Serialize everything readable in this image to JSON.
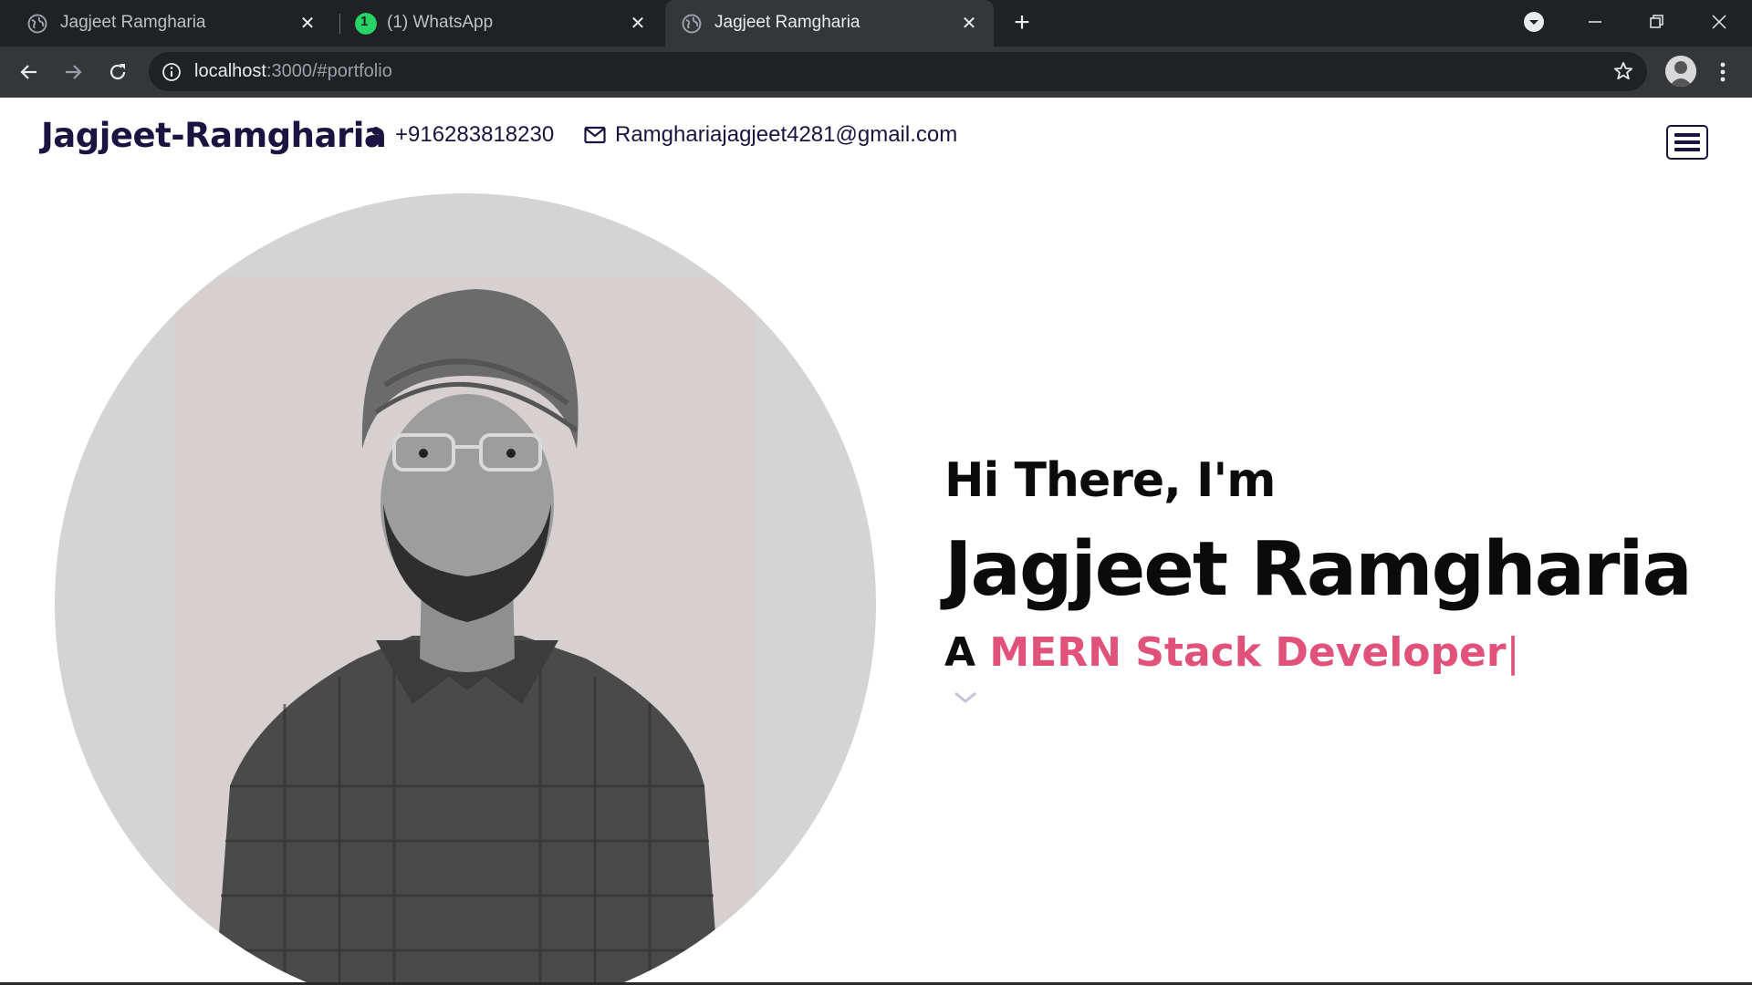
{
  "browser": {
    "tabs": [
      {
        "title": "Jagjeet Ramgharia",
        "icon": "globe-icon",
        "active": false
      },
      {
        "title": "(1) WhatsApp",
        "icon": "whatsapp-icon",
        "badge": "1",
        "active": false
      },
      {
        "title": "Jagjeet Ramgharia",
        "icon": "globe-icon",
        "active": true
      }
    ],
    "url_host": "localhost",
    "url_rest": ":3000/#portfolio"
  },
  "site": {
    "brand": "Jagjeet-Ramgharia",
    "phone": "+916283818230",
    "email": "Ramghariajagjeet4281@gmail.com"
  },
  "hero": {
    "greeting": "Hi There, I'm",
    "name": "Jagjeet Ramgharia",
    "role_prefix": "A ",
    "role_highlight": "MERN Stack Developer",
    "cursor": "|"
  },
  "colors": {
    "brand_text": "#1c1340",
    "accent": "#e0527a",
    "chrome_dark": "#202124",
    "chrome_toolbar": "#35363a"
  }
}
